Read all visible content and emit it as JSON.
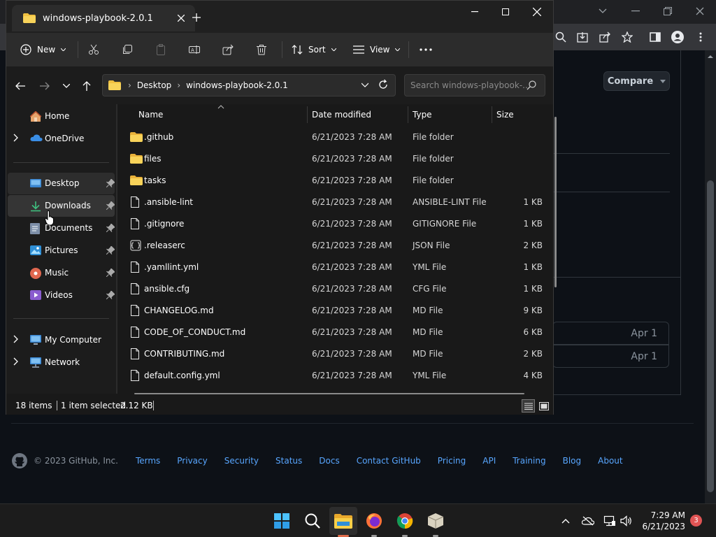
{
  "browser": {
    "compare_label": "Compare",
    "date_cards": [
      "Apr 1",
      "Apr 1"
    ],
    "footer": {
      "copyright": "© 2023 GitHub, Inc.",
      "links": [
        "Terms",
        "Privacy",
        "Security",
        "Status",
        "Docs",
        "Contact GitHub",
        "Pricing",
        "API",
        "Training",
        "Blog",
        "About"
      ]
    }
  },
  "explorer": {
    "tab_title": "windows-playbook-2.0.1",
    "cmdbar": {
      "new_label": "New",
      "sort_label": "Sort",
      "view_label": "View"
    },
    "breadcrumb": [
      "Desktop",
      "windows-playbook-2.0.1"
    ],
    "search_placeholder": "Search windows-playbook-...",
    "nav": {
      "home": "Home",
      "onedrive": "OneDrive",
      "quick": [
        {
          "label": "Desktop",
          "icon": "desktop-icon"
        },
        {
          "label": "Downloads",
          "icon": "downloads-icon"
        },
        {
          "label": "Documents",
          "icon": "documents-icon"
        },
        {
          "label": "Pictures",
          "icon": "pictures-icon"
        },
        {
          "label": "Music",
          "icon": "music-icon"
        },
        {
          "label": "Videos",
          "icon": "videos-icon"
        }
      ],
      "computer": "My Computer",
      "network": "Network"
    },
    "columns": {
      "name": "Name",
      "date": "Date modified",
      "type": "Type",
      "size": "Size"
    },
    "files": [
      {
        "name": ".github",
        "date": "6/21/2023 7:28 AM",
        "type": "File folder",
        "size": "",
        "kind": "folder"
      },
      {
        "name": "files",
        "date": "6/21/2023 7:28 AM",
        "type": "File folder",
        "size": "",
        "kind": "folder"
      },
      {
        "name": "tasks",
        "date": "6/21/2023 7:28 AM",
        "type": "File folder",
        "size": "",
        "kind": "folder"
      },
      {
        "name": ".ansible-lint",
        "date": "6/21/2023 7:28 AM",
        "type": "ANSIBLE-LINT File",
        "size": "1 KB",
        "kind": "file"
      },
      {
        "name": ".gitignore",
        "date": "6/21/2023 7:28 AM",
        "type": "GITIGNORE File",
        "size": "1 KB",
        "kind": "file"
      },
      {
        "name": ".releaserc",
        "date": "6/21/2023 7:28 AM",
        "type": "JSON File",
        "size": "2 KB",
        "kind": "json"
      },
      {
        "name": ".yamllint.yml",
        "date": "6/21/2023 7:28 AM",
        "type": "YML File",
        "size": "1 KB",
        "kind": "file"
      },
      {
        "name": "ansible.cfg",
        "date": "6/21/2023 7:28 AM",
        "type": "CFG File",
        "size": "1 KB",
        "kind": "file"
      },
      {
        "name": "CHANGELOG.md",
        "date": "6/21/2023 7:28 AM",
        "type": "MD File",
        "size": "9 KB",
        "kind": "file"
      },
      {
        "name": "CODE_OF_CONDUCT.md",
        "date": "6/21/2023 7:28 AM",
        "type": "MD File",
        "size": "6 KB",
        "kind": "file"
      },
      {
        "name": "CONTRIBUTING.md",
        "date": "6/21/2023 7:28 AM",
        "type": "MD File",
        "size": "2 KB",
        "kind": "file"
      },
      {
        "name": "default.config.yml",
        "date": "6/21/2023 7:28 AM",
        "type": "YML File",
        "size": "4 KB",
        "kind": "file"
      }
    ],
    "status": {
      "items": "18 items",
      "selected": "1 item selected",
      "size": "2.12 KB"
    }
  },
  "taskbar": {
    "time": "7:29 AM",
    "date": "6/21/2023",
    "notification_count": "3"
  }
}
